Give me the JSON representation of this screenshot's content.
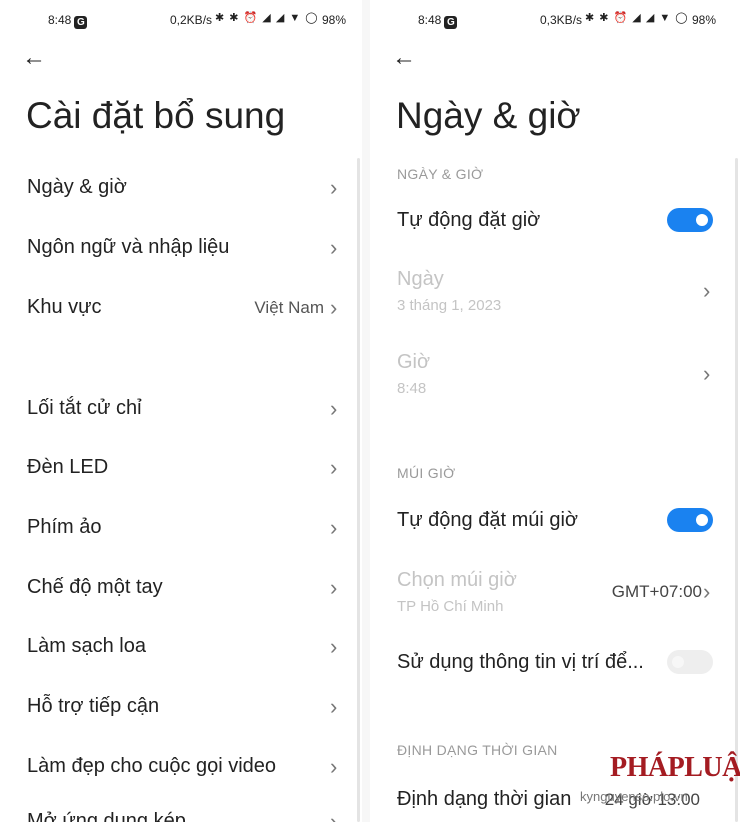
{
  "left": {
    "status": {
      "time": "8:48",
      "badge": "G",
      "net": "0,2KB/s",
      "icons": "✱ ✱ ⏰ ◢ ◢ ▼ ◯",
      "battery": "98%"
    },
    "back": "←",
    "title": "Cài đặt bổ sung",
    "items": [
      {
        "label": "Ngày & giờ",
        "value": ""
      },
      {
        "label": "Ngôn ngữ và nhập liệu",
        "value": ""
      },
      {
        "label": "Khu vực",
        "value": "Việt Nam"
      },
      {
        "label": "Lối tắt cử chỉ",
        "value": ""
      },
      {
        "label": "Đèn LED",
        "value": ""
      },
      {
        "label": "Phím ảo",
        "value": ""
      },
      {
        "label": "Chế độ một tay",
        "value": ""
      },
      {
        "label": "Làm sạch loa",
        "value": ""
      },
      {
        "label": "Hỗ trợ tiếp cận",
        "value": ""
      },
      {
        "label": "Làm đẹp cho cuộc gọi video",
        "value": ""
      },
      {
        "label": "Mở ứng dụng kép",
        "value": ""
      }
    ],
    "chevron": "›"
  },
  "right": {
    "status": {
      "time": "8:48",
      "badge": "G",
      "net": "0,3KB/s",
      "icons": "✱ ✱ ⏰ ◢ ◢ ▼ ◯",
      "battery": "98%"
    },
    "back": "←",
    "title": "Ngày & giờ",
    "section_datetime": "NGÀY & GIỜ",
    "auto_time": {
      "label": "Tự động đặt giờ",
      "on": true
    },
    "date": {
      "label": "Ngày",
      "value": "3 tháng 1, 2023"
    },
    "time": {
      "label": "Giờ",
      "value": "8:48"
    },
    "section_timezone": "MÚI GIỜ",
    "auto_timezone": {
      "label": "Tự động đặt múi giờ",
      "on": true
    },
    "timezone": {
      "label": "Chọn múi giờ",
      "sub": "TP Hồ Chí Minh",
      "value": "GMT+07:00"
    },
    "location": {
      "label": "Sử dụng thông tin vị trí để...",
      "on": false
    },
    "section_format": "ĐỊNH DẠNG THỜI GIAN",
    "time_format": {
      "label": "Định dạng thời gian",
      "value": "24 giờ 13:00"
    },
    "chevron": "›"
  },
  "watermark": {
    "brand": "PHÁPLUẬT",
    "site": "kynguyenso.plo.vn"
  },
  "colors": {
    "accent": "#1a82f0",
    "text": "#222222",
    "disabled": "#c4c4c4",
    "watermark": "#a41c22"
  }
}
